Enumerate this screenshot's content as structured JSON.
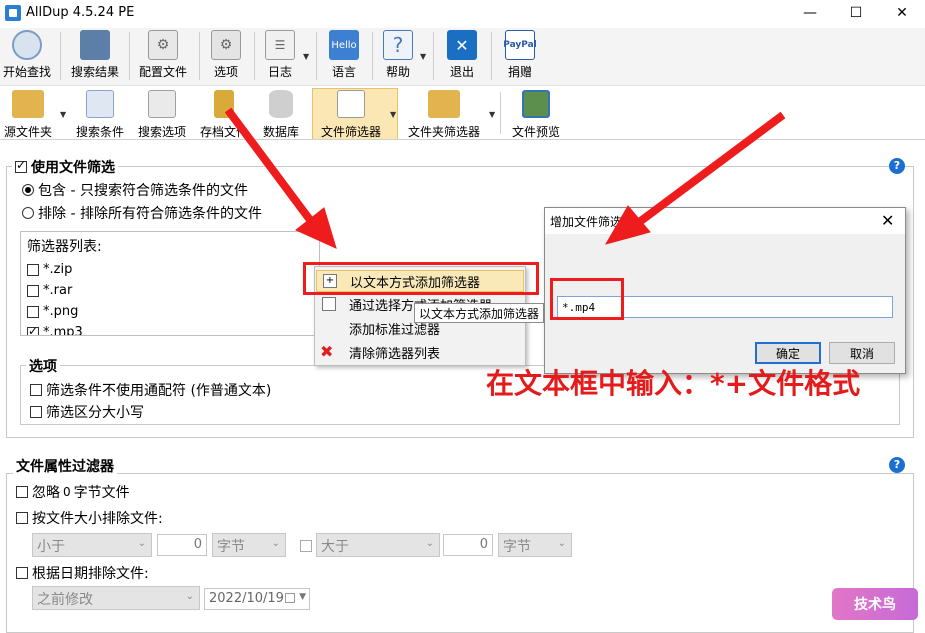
{
  "window": {
    "title": "AllDup 4.5.24 PE",
    "minimize": "—",
    "maximize": "☐",
    "close": "✕"
  },
  "toolbar1": {
    "items": [
      {
        "label": "开始查找",
        "icon": "magnifier-icon",
        "color": "#7a9cc6"
      },
      {
        "label": "搜索结果",
        "icon": "results-icon",
        "color": "#5c7fa8"
      },
      {
        "label": "配置文件",
        "icon": "gear-document-icon",
        "color": "#8a8a8a"
      },
      {
        "label": "选项",
        "icon": "options-icon",
        "color": "#999999"
      },
      {
        "label": "日志",
        "icon": "log-icon",
        "color": "#8f8f8f"
      },
      {
        "label": "语言",
        "icon": "hello-icon",
        "icon_text": "Hello",
        "color": "#3d7fd1"
      },
      {
        "label": "帮助",
        "icon": "help-icon",
        "icon_text": "?",
        "color": "#4a79b8"
      },
      {
        "label": "退出",
        "icon": "exit-icon",
        "icon_text": "✕",
        "color": "#1a6fc2"
      },
      {
        "label": "捐赠",
        "icon": "paypal-icon",
        "icon_text": "PayPal",
        "color": "#2a5aa8"
      }
    ]
  },
  "toolbar2": {
    "items": [
      {
        "label": "源文件夹",
        "icon": "folder-search-icon",
        "color": "#e2b34e"
      },
      {
        "label": "搜索条件",
        "icon": "search-criteria-icon",
        "color": "#8ca6c8"
      },
      {
        "label": "搜索选项",
        "icon": "search-options-icon",
        "color": "#a0a0a0"
      },
      {
        "label": "存档文件",
        "icon": "archive-icon",
        "color": "#d9a93a"
      },
      {
        "label": "数据库",
        "icon": "database-icon",
        "color": "#b0b0b0"
      },
      {
        "label": "文件筛选器",
        "icon": "file-filter-icon",
        "color": "#c9c9c9"
      },
      {
        "label": "文件夹筛选器",
        "icon": "folder-filter-icon",
        "color": "#e2b34e"
      },
      {
        "label": "文件预览",
        "icon": "file-preview-icon",
        "color": "#4a8a4a"
      }
    ]
  },
  "file_filter": {
    "enabled_label": "使用文件筛选",
    "include_label": "包含 - 只搜索符合筛选条件的文件",
    "exclude_label": "排除 - 排除所有符合筛选条件的文件",
    "list_label": "筛选器列表:",
    "items": [
      {
        "label": "*.zip",
        "checked": false
      },
      {
        "label": "*.rar",
        "checked": false
      },
      {
        "label": "*.png",
        "checked": false
      },
      {
        "label": "*.mp3",
        "checked": true
      }
    ],
    "help": "?"
  },
  "options": {
    "title": "选项",
    "no_wildcards": "筛选条件不使用通配符 (作普通文本)",
    "case_sensitive": "筛选区分大小写"
  },
  "context_menu": {
    "items": [
      {
        "label": "以文本方式添加筛选器",
        "icon": "add-text-icon"
      },
      {
        "label": "通过选择方式添加筛选器",
        "icon": "add-select-icon"
      },
      {
        "label": "添加标准过滤器",
        "icon": ""
      },
      {
        "label": "清除筛选器列表",
        "icon": "clear-icon"
      }
    ],
    "tooltip": "以文本方式添加筛选器"
  },
  "dialog": {
    "title": "增加文件筛选器",
    "input_value": "*.mp4",
    "ok": "确定",
    "cancel": "取消",
    "close": "✕"
  },
  "annotation": {
    "caption": "在文本框中输入：*+文件格式",
    "color": "#ee1c1c"
  },
  "attribute_filter": {
    "title": "文件属性过滤器",
    "help": "?",
    "ignore_prefix": "忽略",
    "ignore_count": "0",
    "ignore_suffix": "字节文件",
    "size_label": "按文件大小排除文件:",
    "less_than": "小于",
    "size1_value": "0",
    "unit1": "字节",
    "greater_than": "大于",
    "size2_value": "0",
    "unit2": "字节",
    "date_label": "根据日期排除文件:",
    "date_mode": "之前修改",
    "date_value": "2022/10/19"
  },
  "watermark": {
    "text": "技术鸟"
  }
}
